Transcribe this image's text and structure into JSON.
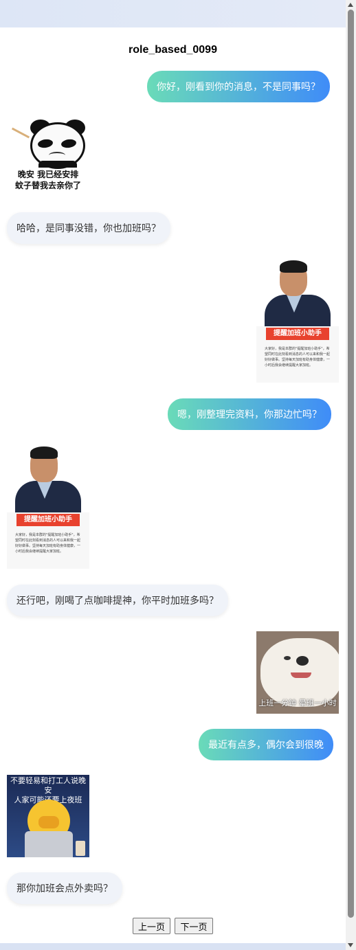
{
  "title": "role_based_0099",
  "messages": [
    {
      "text": "你好，刚看到你的消息，不是同事吗？"
    },
    {
      "sticker_caption": "晚安 我已经安排\n蚊子替我去亲你了"
    },
    {
      "text": "哈哈，是同事没错，你也加班吗？"
    },
    {
      "sticker_banner": "提醒加班小助手",
      "sticker_desc": "大家好，我是本群的\"提醒加班小助手\"，希望同时在此刻看到消息的人可以来和我一起好好做事。坚持每天加班有助身体健康，一小时后我会继续提醒大家加班。"
    },
    {
      "text": "嗯，刚整理完资料，你那边忙吗？"
    },
    {
      "sticker_banner": "提醒加班小助手",
      "sticker_desc": "大家好，我是本群的\"提醒加班小助手\"，希望同时在此刻看到消息的人可以来和我一起好好做事。坚持每天加班有助身体健康，一小时后我会继续提醒大家加班。"
    },
    {
      "text": "还行吧，刚喝了点咖啡提神，你平时加班多吗？"
    },
    {
      "sticker_caption": "上班一分钟 晕班一小时"
    },
    {
      "text": "最近有点多，偶尔会到很晚"
    },
    {
      "sticker_caption": "不要轻易和打工人说晚安\n人家可能还要上夜班"
    },
    {
      "text": "那你加班会点外卖吗？"
    }
  ],
  "pager": {
    "prev": "上一页",
    "next": "下一页"
  }
}
